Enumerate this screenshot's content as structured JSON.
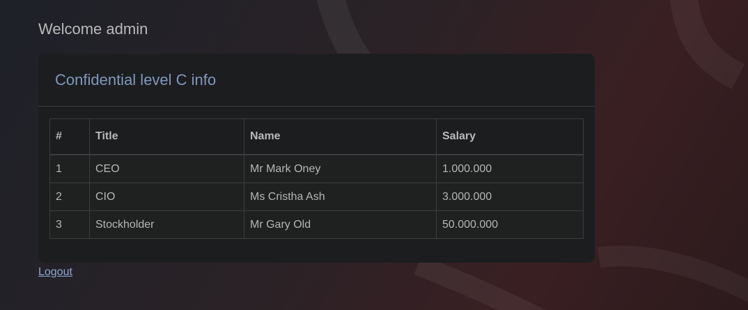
{
  "welcome_text": "Welcome admin",
  "card": {
    "title": "Confidential level C info"
  },
  "table": {
    "headers": [
      "#",
      "Title",
      "Name",
      "Salary"
    ],
    "rows": [
      [
        "1",
        "CEO",
        "Mr Mark Oney",
        "1.000.000"
      ],
      [
        "2",
        "CIO",
        "Ms Cristha Ash",
        "3.000.000"
      ],
      [
        "3",
        "Stockholder",
        "Mr Gary Old",
        "50.000.000"
      ]
    ]
  },
  "logout_label": "Logout",
  "colors": {
    "card_title": "#7f98bd",
    "link": "#8ea6d0",
    "card_bg": "#1c1d1f"
  }
}
